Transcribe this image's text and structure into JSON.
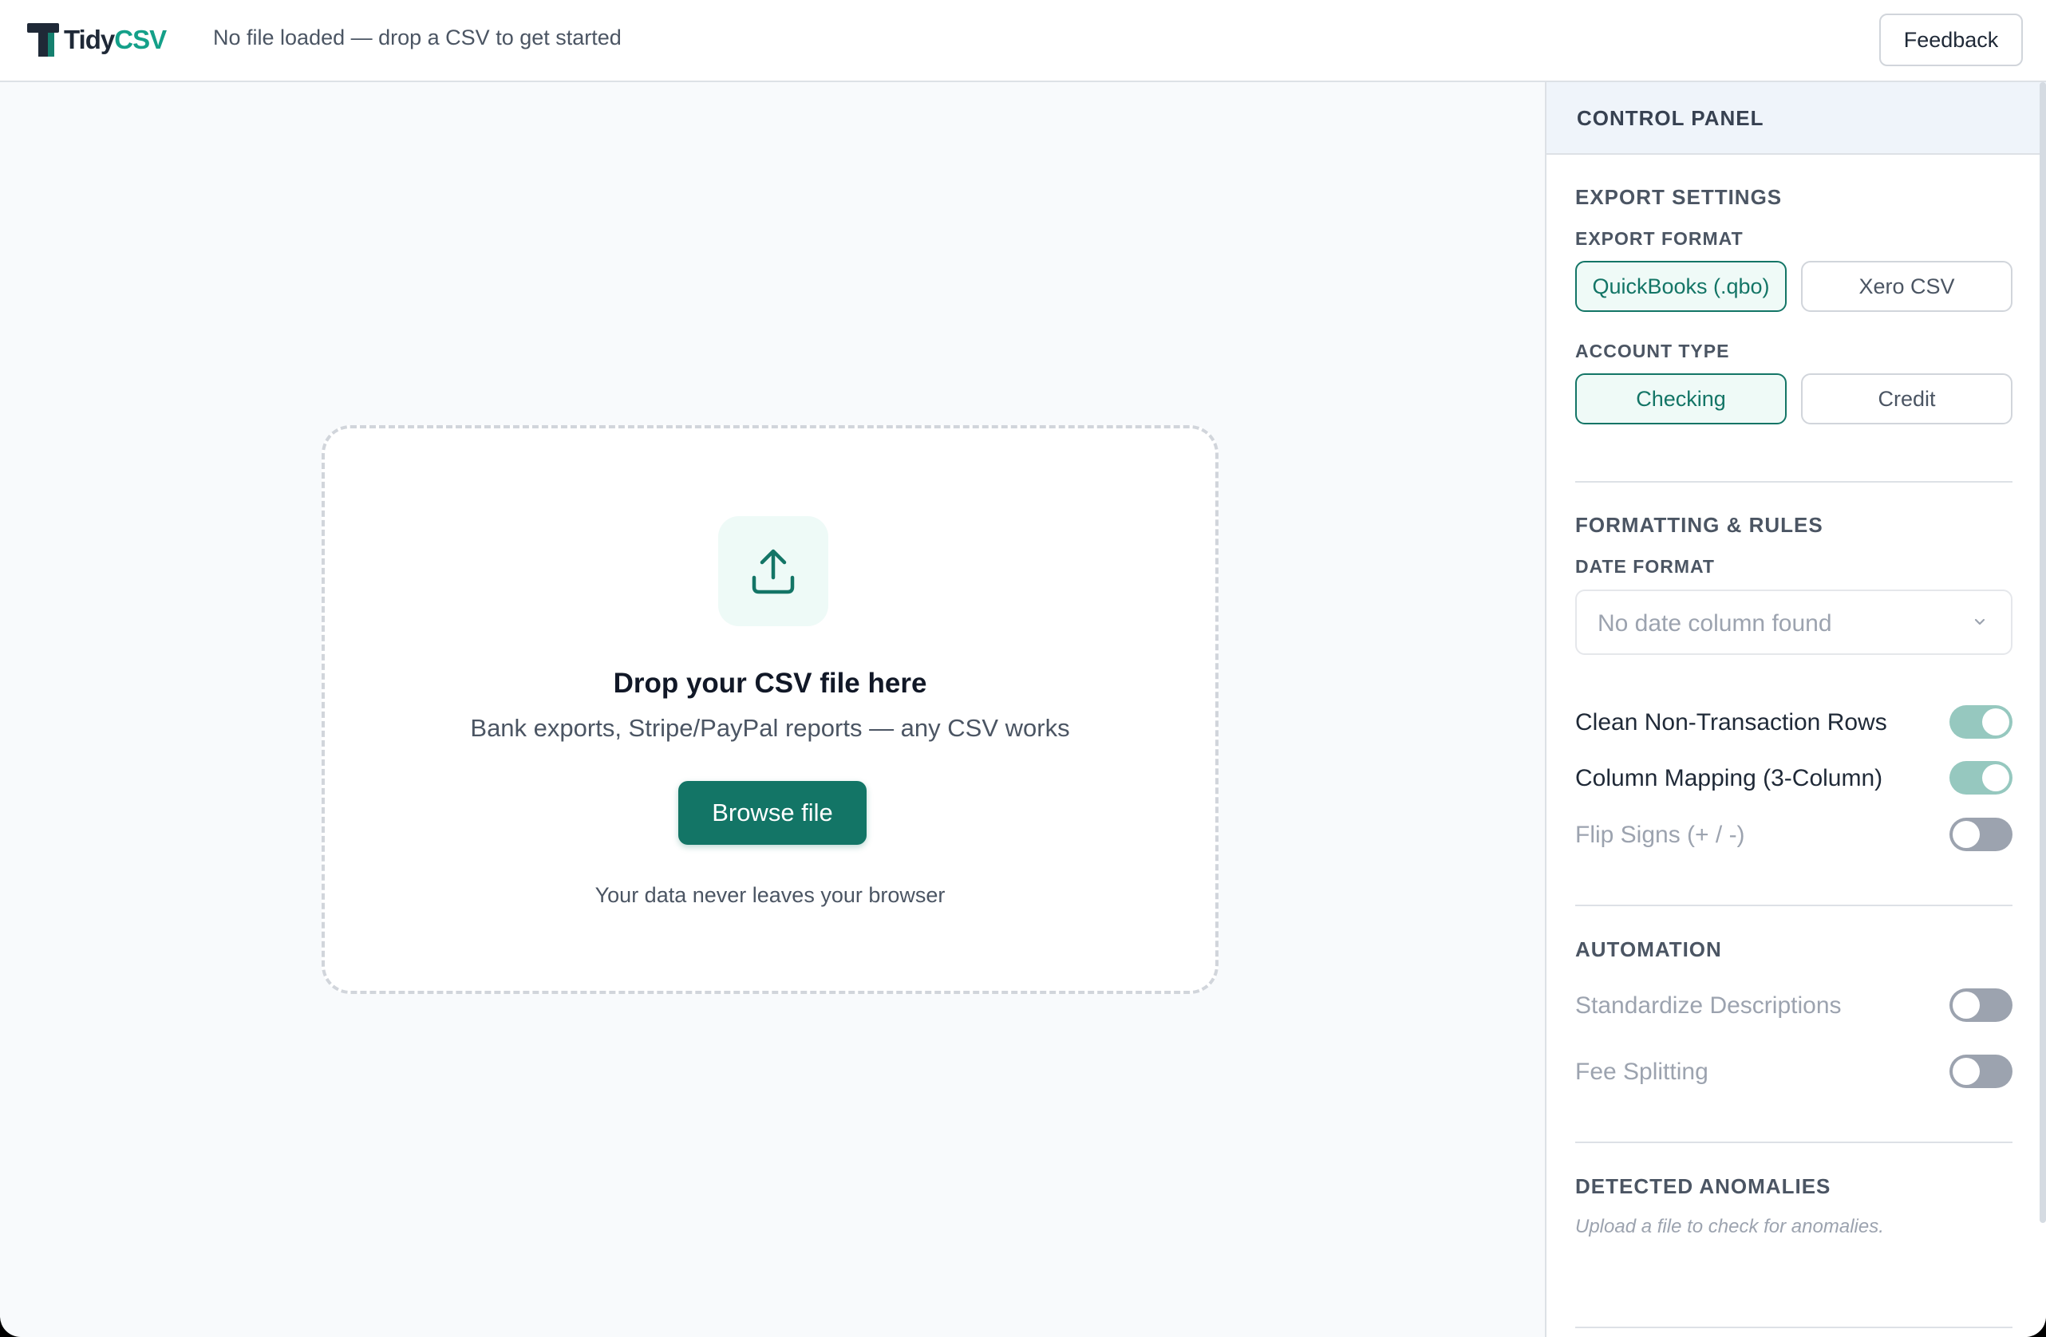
{
  "app": {
    "logo_part1": "Tidy",
    "logo_part2": "CSV",
    "status": "No file loaded — drop a CSV to get started",
    "feedback_label": "Feedback"
  },
  "dropzone": {
    "title": "Drop your CSV file here",
    "subtitle": "Bank exports, Stripe/PayPal reports — any CSV works",
    "browse_label": "Browse file",
    "privacy_note": "Your data never leaves your browser",
    "icon": "upload-icon"
  },
  "panel": {
    "title": "CONTROL PANEL",
    "export_settings": {
      "title": "EXPORT SETTINGS",
      "export_format_label": "EXPORT FORMAT",
      "export_format_options": [
        "QuickBooks (.qbo)",
        "Xero CSV"
      ],
      "export_format_selected": "QuickBooks (.qbo)",
      "account_type_label": "ACCOUNT TYPE",
      "account_type_options": [
        "Checking",
        "Credit"
      ],
      "account_type_selected": "Checking"
    },
    "formatting": {
      "title": "FORMATTING & RULES",
      "date_format_label": "DATE FORMAT",
      "date_format_value": "No date column found",
      "toggles": [
        {
          "label": "Clean Non-Transaction Rows",
          "on": true
        },
        {
          "label": "Column Mapping (3-Column)",
          "on": true
        },
        {
          "label": "Flip Signs (+ / -)",
          "on": false
        }
      ]
    },
    "automation": {
      "title": "AUTOMATION",
      "toggles": [
        {
          "label": "Standardize Descriptions",
          "on": false
        },
        {
          "label": "Fee Splitting",
          "on": false
        }
      ]
    },
    "anomalies": {
      "title": "DETECTED ANOMALIES",
      "note": "Upload a file to check for anomalies."
    }
  },
  "colors": {
    "accent": "#137566",
    "accent_light": "#14a089",
    "toggle_on": "#96c8bf",
    "toggle_off": "#9ca3af"
  }
}
